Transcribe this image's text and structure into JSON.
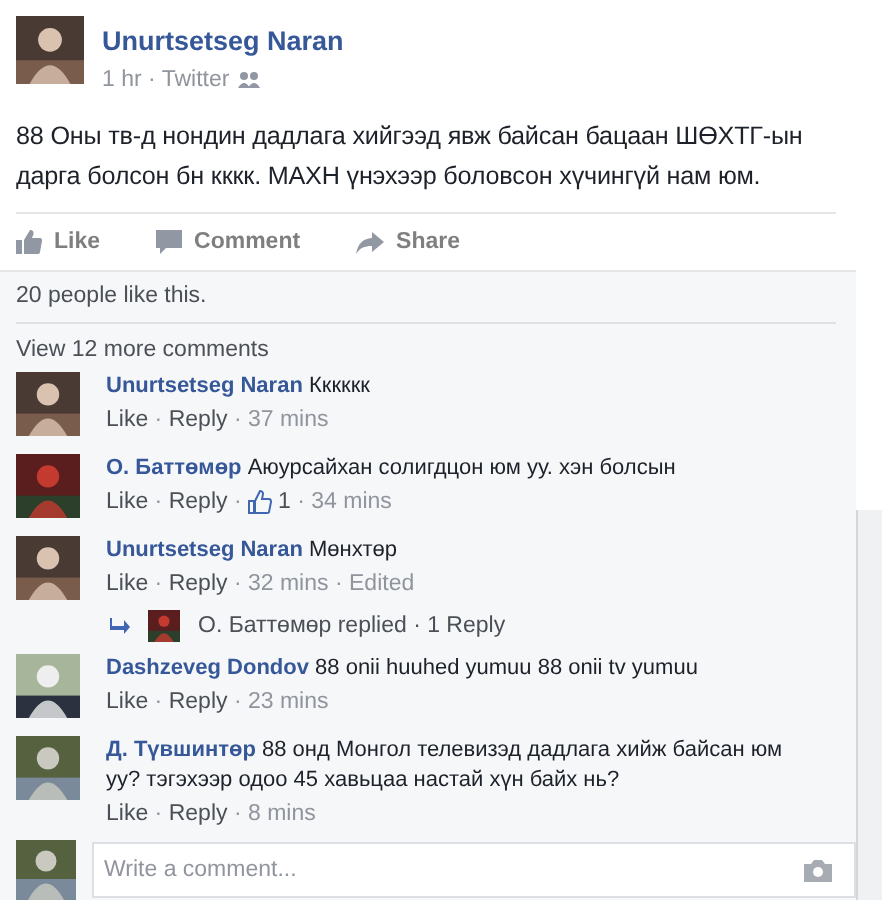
{
  "post": {
    "author": "Unurtsetseg Naran",
    "meta": [
      "1 hr",
      "Twitter"
    ],
    "text": "88 Оны тв-д нондин дадлага хийгээд явж байсан бацаан ШӨХТГ-ын дарга болсон бн кккк. МАХН үнэхээр боловсон хүчингүй нам юм.",
    "actions": [
      {
        "kind": "like",
        "label": "Like"
      },
      {
        "kind": "comment",
        "label": "Comment"
      },
      {
        "kind": "share",
        "label": "Share"
      }
    ]
  },
  "likes": "20 people like this.",
  "separator": " · ",
  "view_more": "View 12 more comments",
  "comments": [
    {
      "author": "Unurtsetseg Naran",
      "text": "Кккккк",
      "meta": [
        {
          "kind": "link",
          "text": "Like"
        },
        {
          "kind": "link",
          "text": "Reply"
        },
        {
          "kind": "time",
          "text": "37 mins"
        }
      ]
    },
    {
      "author": "О. Баттөмөр",
      "text": "Аюурсайхан солигдцон юм уу. хэн болсын",
      "meta": [
        {
          "kind": "link",
          "text": "Like"
        },
        {
          "kind": "link",
          "text": "Reply"
        },
        {
          "kind": "likes",
          "text": "1"
        },
        {
          "kind": "time",
          "text": "34 mins"
        }
      ]
    },
    {
      "author": "Unurtsetseg Naran",
      "text": "Мөнхтөр",
      "meta": [
        {
          "kind": "link",
          "text": "Like"
        },
        {
          "kind": "link",
          "text": "Reply"
        },
        {
          "kind": "time",
          "text": "32 mins"
        },
        {
          "kind": "time",
          "text": "Edited"
        }
      ],
      "reply": "О. Баттөмөр replied · 1 Reply"
    },
    {
      "author": "Dashzeveg Dondov",
      "text": "88 onii huuhed yumuu 88 onii tv yumuu",
      "meta": [
        {
          "kind": "link",
          "text": "Like"
        },
        {
          "kind": "link",
          "text": "Reply"
        },
        {
          "kind": "time",
          "text": "23 mins"
        }
      ]
    },
    {
      "author": "Д. Түвшинтөр",
      "text": "88 онд Монгол телевизэд дадлага хийж байсан юм уу? тэгэхээр одоо 45 хавьцаа настай хүн байх нь?",
      "meta": [
        {
          "kind": "link",
          "text": "Like"
        },
        {
          "kind": "link",
          "text": "Reply"
        },
        {
          "kind": "time",
          "text": "8 mins"
        }
      ]
    }
  ],
  "composer": {
    "placeholder": "Write a comment..."
  }
}
